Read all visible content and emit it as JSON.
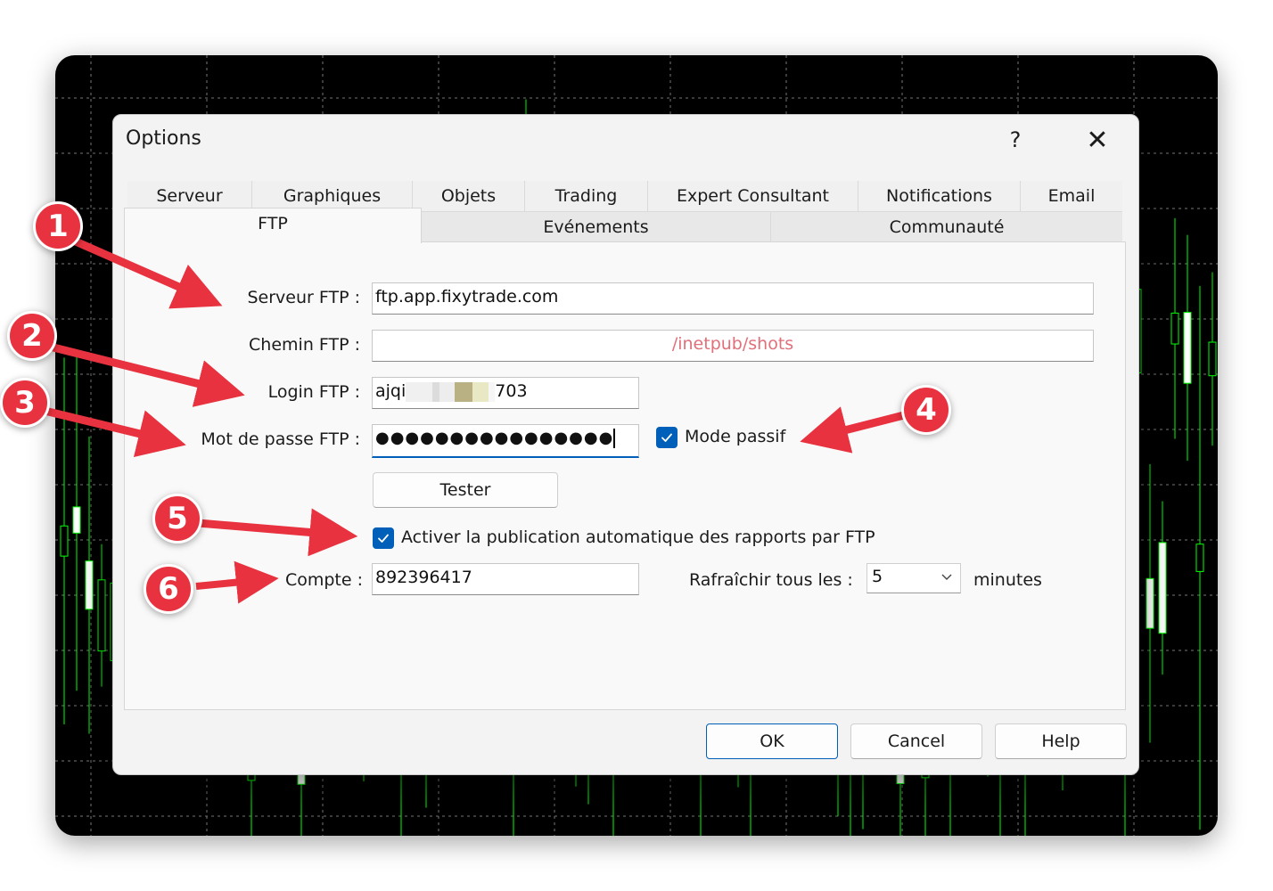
{
  "dialog": {
    "title": "Options",
    "help_glyph": "?",
    "close_glyph": "✕"
  },
  "tabs": {
    "row1": [
      "Serveur",
      "Graphiques",
      "Objets",
      "Trading",
      "Expert Consultant",
      "Notifications",
      "Email"
    ],
    "row2": [
      "FTP",
      "Evénements",
      "Communauté"
    ],
    "active": "FTP"
  },
  "form": {
    "server_label": "Serveur FTP :",
    "server_value": "ftp.app.fixytrade.com",
    "path_label": "Chemin FTP :",
    "path_value": "/inetpub/shots",
    "login_label": "Login FTP :",
    "login_prefix": "ajqi",
    "login_suffix": "703",
    "password_label": "Mot de passe FTP :",
    "password_value": "●●●●●●●●●●●●●●●●",
    "passive_label": "Mode passif",
    "passive_checked": true,
    "test_button": "Tester",
    "autopublish_label": "Activer la publication automatique des rapports par FTP",
    "autopublish_checked": true,
    "account_label": "Compte :",
    "account_value": "892396417",
    "refresh_label": "Rafraîchir tous les :",
    "refresh_value": "5",
    "refresh_unit": "minutes"
  },
  "buttons": {
    "ok": "OK",
    "cancel": "Cancel",
    "help": "Help"
  },
  "annotations": {
    "badges": [
      "1",
      "2",
      "3",
      "4",
      "5",
      "6"
    ],
    "color": "#e8323f"
  },
  "colors": {
    "accent": "#005fb8",
    "disabled_text": "#e0707a",
    "chart_background": "#000000",
    "candle_color": "#00ff00"
  }
}
